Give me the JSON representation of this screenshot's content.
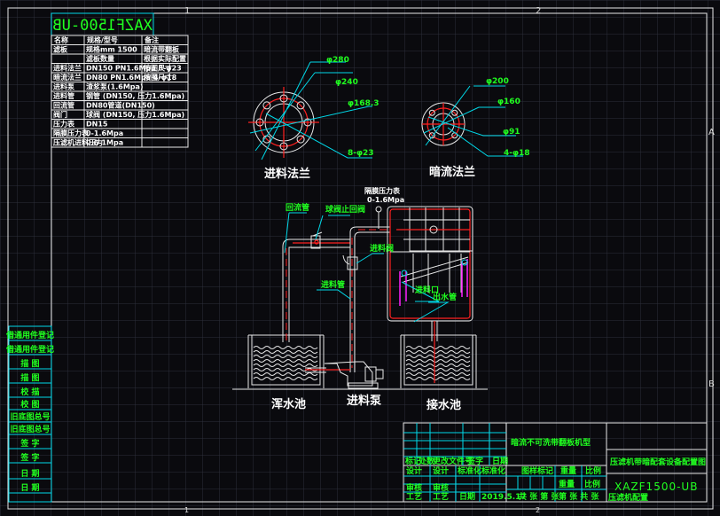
{
  "drawing_number": "XAZF1500-UB",
  "zone_markers": {
    "col1": "1",
    "col2": "2",
    "rowA": "A",
    "rowB": "B"
  },
  "spec_table": {
    "headers": [
      "名称",
      "规格/型号",
      "备注"
    ],
    "rows": [
      {
        "name": "滤板",
        "spec": "规格mm 1500",
        "note": "暗流带翻板"
      },
      {
        "name": "",
        "spec": "滤板数量",
        "note": "根据实际配置"
      },
      {
        "name": "进料法兰",
        "spec": "DN150 PN1.6Mpa 8-φ23",
        "note": "按图尺寸"
      },
      {
        "name": "暗流法兰",
        "spec": "DN80 PN1.6Mpa 4-φ18",
        "note": "按图尺寸"
      },
      {
        "name": "进料泵",
        "spec": "渣浆泵(1.6Mpa)",
        "note": ""
      },
      {
        "name": "进料管",
        "spec": "钢管 (DN150, 压力1.6Mpa)",
        "note": ""
      },
      {
        "name": "回流管",
        "spec": "DN80管道(DN150)",
        "note": ""
      },
      {
        "name": "阀门",
        "spec": "球阀 (DN150, 压力1.6Mpa)",
        "note": ""
      },
      {
        "name": "压力表",
        "spec": "DN15",
        "note": ""
      },
      {
        "name": "隔膜压力表",
        "spec": "0-1.6Mpa",
        "note": ""
      },
      {
        "name": "压滤机进料压力",
        "spec": "0.6-1Mpa",
        "note": ""
      }
    ]
  },
  "flange_left": {
    "caption": "进料法兰",
    "dims": [
      "φ280",
      "φ240",
      "φ168.3",
      "8-φ23"
    ]
  },
  "flange_right": {
    "caption": "暗流法兰",
    "dims": [
      "φ200",
      "φ160",
      "φ91",
      "4-φ18"
    ]
  },
  "callouts": {
    "gauge": "隔膜压力表",
    "gauge_range": "0-1.6Mpa",
    "return_pipe": "回流管",
    "valve": "球阀止回阀",
    "gate_valve": "进料阀",
    "feed_pipe": "进料管",
    "filter_inlet": "进料口",
    "drain": "出水管"
  },
  "labels": {
    "left_tank": "浑水池",
    "pump": "进料泵",
    "right_tank": "接水池"
  },
  "side_panel": [
    "借通用件登记",
    "借通用件登记",
    "描 图",
    "描 图",
    "校 描",
    "校 图",
    "旧底图总号",
    "旧底图总号",
    "签 字",
    "签 字",
    "日 期",
    "日 期"
  ],
  "title_block": {
    "product": "暗流不可洗带翻板机型",
    "title": "压滤机带暗配套设备配置图",
    "code": "XAZF1500-UB",
    "rev_headers": [
      "标记",
      "处数",
      "更改文件号",
      "签字",
      "日期"
    ],
    "design": "设计",
    "design_val": "设计",
    "standard": "标准化",
    "standard_val": "标准化",
    "review": "审核",
    "review_val": "审核",
    "process": "工艺",
    "process_val": "工艺",
    "date_lbl": "日期",
    "date_val": "2019.5.17",
    "stage": "图样标记",
    "weight": "重量",
    "scale": "比例",
    "weight_val": "重量",
    "scale_val": "比例",
    "sheets": "共 张 第 张",
    "sheet2": "第 张 共 张",
    "company": "压滤机配置"
  }
}
